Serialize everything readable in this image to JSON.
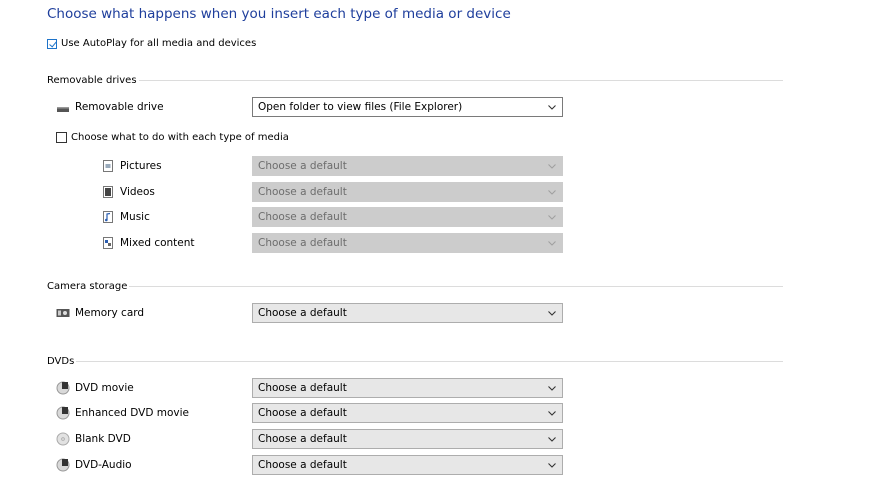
{
  "title": "Choose what happens when you insert each type of media or device",
  "autoplay": {
    "label": "Use AutoPlay for all media and devices",
    "checked": true
  },
  "removable_drives": {
    "heading": "Removable drives",
    "drive": {
      "label": "Removable drive",
      "value": "Open folder to view files (File Explorer)",
      "icon": "removable-drive-icon"
    },
    "media_choice": {
      "label": "Choose what to do with each type of media",
      "checked": false
    },
    "media_items": [
      {
        "label": "Pictures",
        "value": "Choose a default",
        "icon": "pictures-icon"
      },
      {
        "label": "Videos",
        "value": "Choose a default",
        "icon": "videos-icon"
      },
      {
        "label": "Music",
        "value": "Choose a default",
        "icon": "music-icon"
      },
      {
        "label": "Mixed content",
        "value": "Choose a default",
        "icon": "mixed-content-icon"
      }
    ]
  },
  "camera_storage": {
    "heading": "Camera storage",
    "memory_card": {
      "label": "Memory card",
      "value": "Choose a default",
      "icon": "memory-card-icon"
    }
  },
  "dvds": {
    "heading": "DVDs",
    "items": [
      {
        "label": "DVD movie",
        "value": "Choose a default",
        "icon": "dvd-movie-icon"
      },
      {
        "label": "Enhanced DVD movie",
        "value": "Choose a default",
        "icon": "enhanced-dvd-movie-icon"
      },
      {
        "label": "Blank DVD",
        "value": "Choose a default",
        "icon": "blank-dvd-icon"
      },
      {
        "label": "DVD-Audio",
        "value": "Choose a default",
        "icon": "dvd-audio-icon"
      }
    ]
  },
  "colors": {
    "title": "#1e3e9c",
    "check_accent": "#1d73c9",
    "disabled_fill": "#cccccc"
  }
}
